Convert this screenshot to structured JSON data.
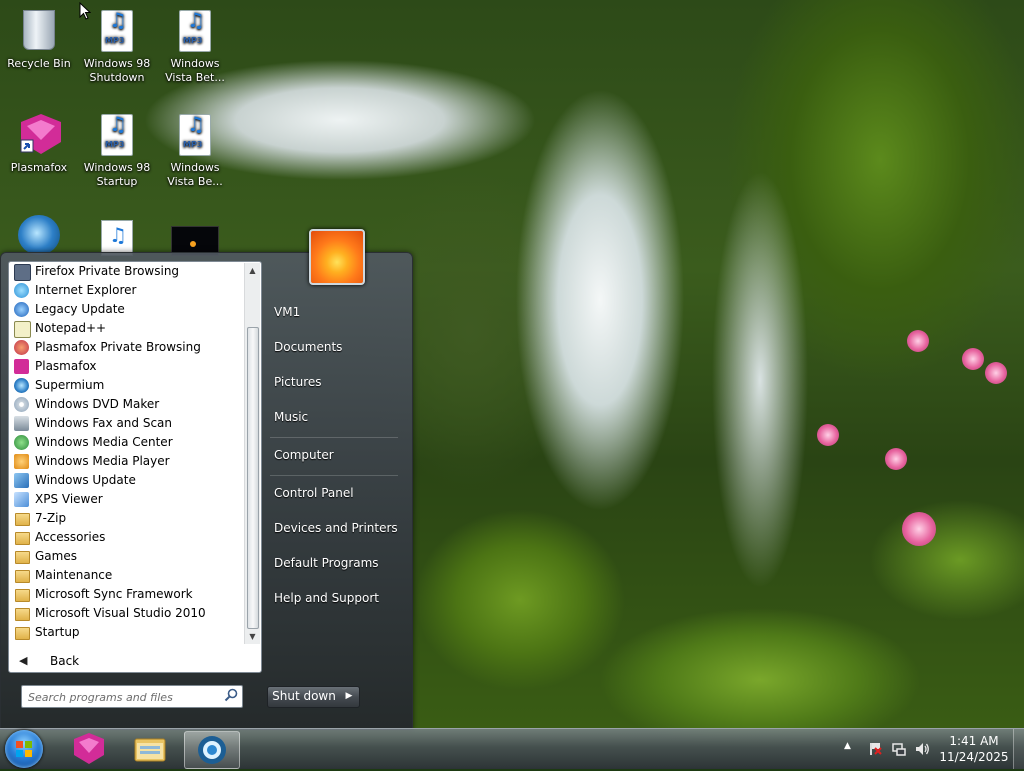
{
  "desktop": {
    "icons": [
      {
        "label": "Recycle Bin",
        "kind": "recycle-bin"
      },
      {
        "label": "Windows 98 Shutdown",
        "kind": "mp3"
      },
      {
        "label": "Windows Vista Bet...",
        "kind": "mp3"
      },
      {
        "label": "Plasmafox",
        "kind": "plasmafox-shortcut"
      },
      {
        "label": "Windows 98 Startup",
        "kind": "mp3"
      },
      {
        "label": "Windows Vista Be...",
        "kind": "mp3"
      }
    ]
  },
  "start_menu": {
    "programs": [
      {
        "label": "Firefox Private Browsing",
        "icon": "firefox-private-icon"
      },
      {
        "label": "Internet Explorer",
        "icon": "internet-explorer-icon"
      },
      {
        "label": "Legacy Update",
        "icon": "legacy-update-icon"
      },
      {
        "label": "Notepad++",
        "icon": "notepad-plus-plus-icon"
      },
      {
        "label": "Plasmafox Private Browsing",
        "icon": "plasmafox-private-icon"
      },
      {
        "label": "Plasmafox",
        "icon": "plasmafox-icon"
      },
      {
        "label": "Supermium",
        "icon": "supermium-icon"
      },
      {
        "label": "Windows DVD Maker",
        "icon": "dvd-maker-icon"
      },
      {
        "label": "Windows Fax and Scan",
        "icon": "fax-scan-icon"
      },
      {
        "label": "Windows Media Center",
        "icon": "media-center-icon"
      },
      {
        "label": "Windows Media Player",
        "icon": "media-player-icon"
      },
      {
        "label": "Windows Update",
        "icon": "windows-update-icon"
      },
      {
        "label": "XPS Viewer",
        "icon": "xps-viewer-icon"
      },
      {
        "label": "7-Zip",
        "icon": "folder-icon"
      },
      {
        "label": "Accessories",
        "icon": "folder-icon"
      },
      {
        "label": "Games",
        "icon": "folder-icon"
      },
      {
        "label": "Maintenance",
        "icon": "folder-icon"
      },
      {
        "label": "Microsoft Sync Framework",
        "icon": "folder-icon"
      },
      {
        "label": "Microsoft Visual Studio 2010",
        "icon": "folder-icon"
      },
      {
        "label": "Startup",
        "icon": "folder-icon"
      }
    ],
    "back_label": "Back",
    "search_placeholder": "Search programs and files",
    "right_links": {
      "user": "VM1",
      "documents": "Documents",
      "pictures": "Pictures",
      "music": "Music",
      "computer": "Computer",
      "control_panel": "Control Panel",
      "devices_printers": "Devices and Printers",
      "default_programs": "Default Programs",
      "help_support": "Help and Support"
    },
    "shutdown_label": "Shut down"
  },
  "taskbar": {
    "pinned": [
      "plasmafox-icon",
      "file-explorer-icon",
      "supermium-icon"
    ],
    "active": "supermium-icon",
    "clock_time": "1:41 AM",
    "clock_date": "11/24/2025"
  },
  "colors": {
    "start_orb": "#2b7fd8",
    "accent_blue": "#1e78d8"
  }
}
